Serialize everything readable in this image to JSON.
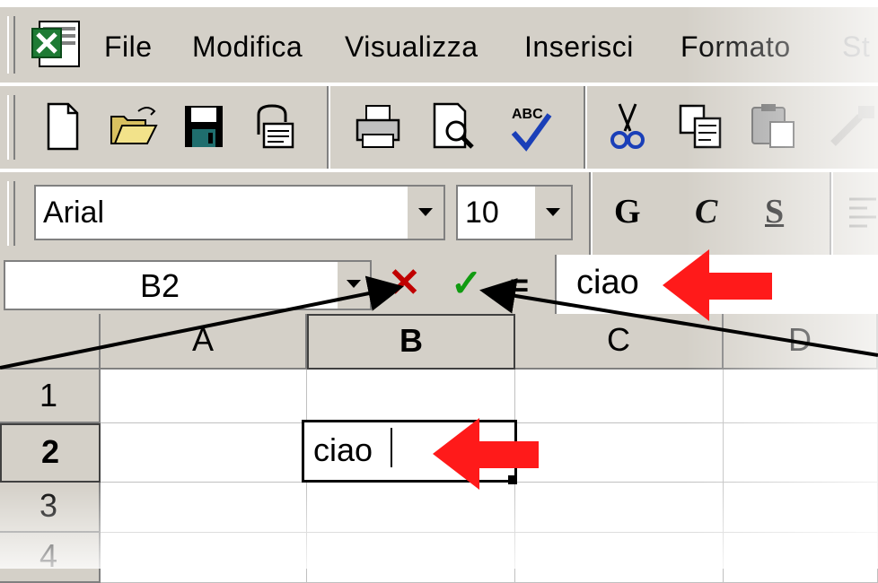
{
  "menubar": {
    "items": [
      {
        "label": "File",
        "disabled": false
      },
      {
        "label": "Modifica",
        "disabled": false
      },
      {
        "label": "Visualizza",
        "disabled": false
      },
      {
        "label": "Inserisci",
        "disabled": false
      },
      {
        "label": "Formato",
        "disabled": false
      },
      {
        "label": "St",
        "disabled": true
      }
    ]
  },
  "standard_toolbar": {
    "icons": [
      "new-document-icon",
      "open-folder-icon",
      "save-icon",
      "mail-icon",
      "print-icon",
      "print-preview-icon",
      "spelling-icon",
      "cut-icon",
      "copy-icon",
      "paste-icon"
    ],
    "spelling_label": "ABC"
  },
  "format_toolbar": {
    "font_name": "Arial",
    "font_size": "10",
    "bold": "G",
    "italic": "C",
    "underline": "S"
  },
  "formula_bar": {
    "name_box": "B2",
    "cancel_glyph": "✕",
    "enter_glyph": "✓",
    "equals_glyph": "=",
    "content": "ciao"
  },
  "grid": {
    "columns": [
      "A",
      "B",
      "C",
      "D"
    ],
    "rows": [
      "1",
      "2",
      "3",
      "4"
    ],
    "selected_column": "B",
    "selected_row": "2",
    "active_cell_value": "ciao"
  },
  "colors": {
    "face": "#d4d0c8",
    "arrow_red": "#ff1a1a",
    "cancel_red": "#c00000",
    "enter_green": "#119b11",
    "excel_green": "#1e7b34"
  }
}
